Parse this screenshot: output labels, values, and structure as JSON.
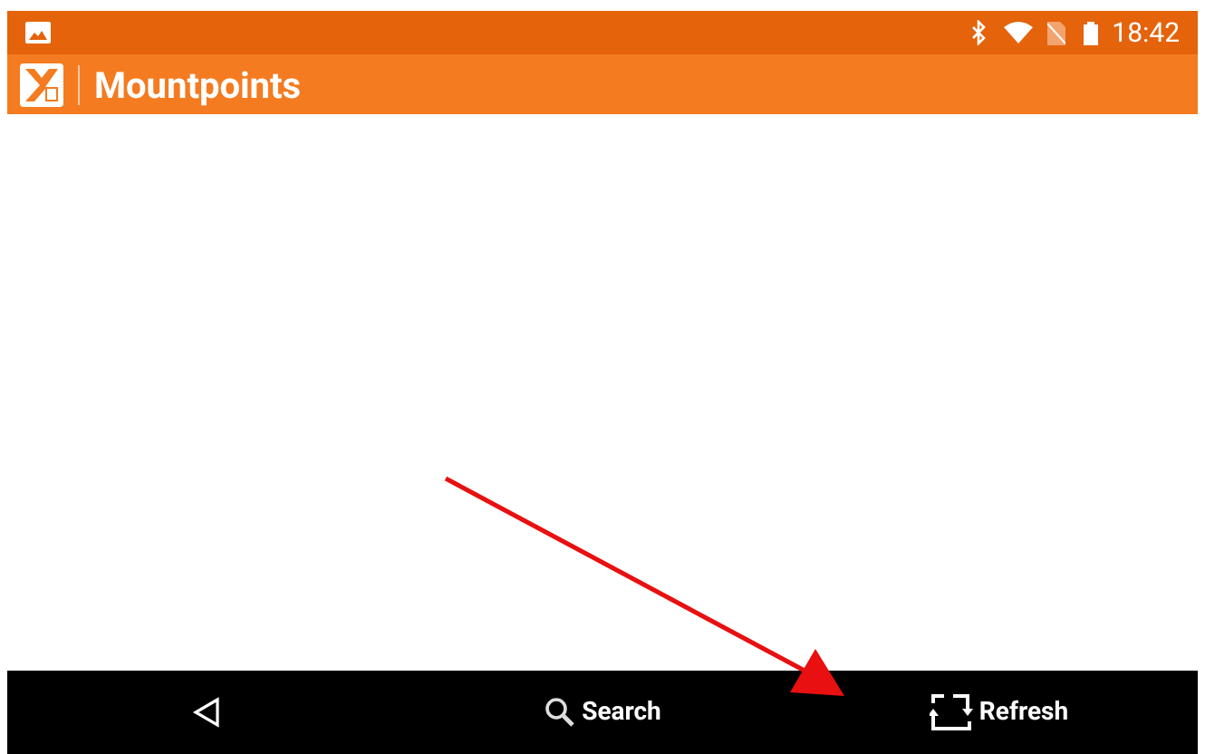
{
  "status_bar": {
    "time": "18:42"
  },
  "app_bar": {
    "title": "Mountpoints"
  },
  "bottom_bar": {
    "buttons": [
      {
        "kind": "back"
      },
      {
        "kind": "search",
        "label": "Search"
      },
      {
        "kind": "refresh",
        "label": "Refresh"
      }
    ]
  }
}
